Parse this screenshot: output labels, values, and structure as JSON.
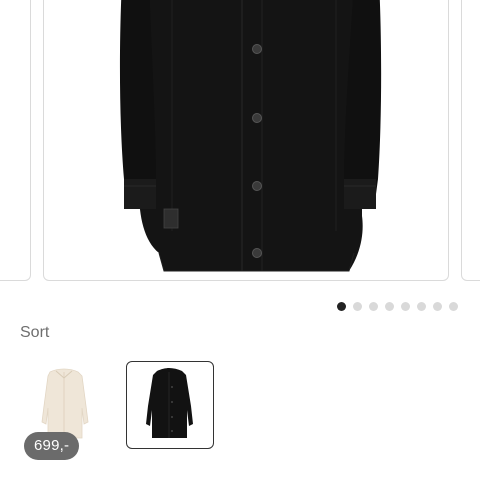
{
  "product": {
    "color_label": "Sort",
    "price": "699,-",
    "image_count": 8,
    "active_image_index": 0
  },
  "swatches": [
    {
      "name": "cream",
      "color": "#efe6d8",
      "selected": false
    },
    {
      "name": "black",
      "color": "#121212",
      "selected": true
    }
  ],
  "colors": {
    "coat": "#141414",
    "dot_active": "#222222",
    "dot_inactive": "#d9d9d9",
    "price_badge": "#6b6b6b"
  },
  "icons": [
    "coat-product-image"
  ]
}
